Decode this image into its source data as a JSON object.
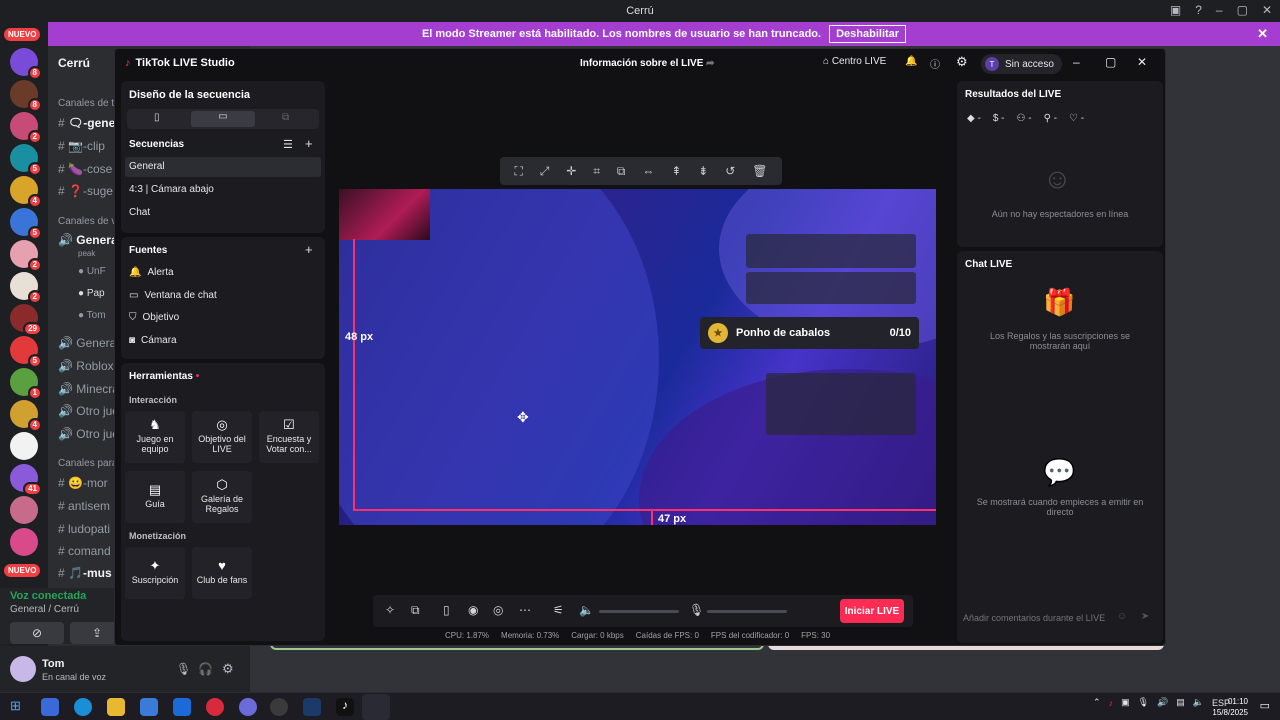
{
  "window_title": "Cerrú",
  "banner": {
    "text": "El modo Streamer está habilitado. Los nombres de usuario se han truncado.",
    "button": "Deshabilitar"
  },
  "rail": {
    "nuevo_top": "NUEVO",
    "nuevo_bottom": "NUEVO",
    "badges": [
      "8",
      "8",
      "2",
      "5",
      "4",
      "5",
      "2",
      "2",
      "29",
      "5",
      "1",
      "4",
      "41"
    ]
  },
  "server": {
    "name": "Cerrú"
  },
  "channels": {
    "cat_text": "Canales de te",
    "text": [
      "🗨-gene",
      "📷-clip",
      "🍆-cose",
      "❓-suge"
    ],
    "cat_voice": "Canales de vo",
    "general": "General",
    "general_sub": "peak",
    "members": [
      "UnF",
      "Pap",
      "Tom"
    ],
    "voice": [
      "General",
      "Roblox",
      "Minecra",
      "Otro jue",
      "Otro jue"
    ],
    "cat_para": "Canales para l",
    "para": [
      "😀-mor",
      "antisem",
      "ludopati",
      "comand",
      "🎵-mus"
    ]
  },
  "voice": {
    "status": "Voz conectada",
    "location": "General / Cerrú"
  },
  "user": {
    "name": "Tom",
    "status": "En canal de voz"
  },
  "studio": {
    "app_name": "TikTok LIVE Studio",
    "info": "Información sobre el LIVE",
    "centro": "Centro LIVE",
    "account": "Sin acceso",
    "account_initial": "T",
    "design_title": "Diseño de la secuencia",
    "secuencias": "Secuencias",
    "scenes": [
      "General",
      "4:3 | Cámara abajo",
      "Chat"
    ],
    "fuentes": "Fuentes",
    "sources": [
      {
        "icon": "bell-icon",
        "label": "Alerta"
      },
      {
        "icon": "chat-window-icon",
        "label": "Ventana de chat"
      },
      {
        "icon": "shield-icon",
        "label": "Objetivo"
      },
      {
        "icon": "camera-icon",
        "label": "Cámara"
      }
    ],
    "herramientas": "Herramientas",
    "interaccion": "Interacción",
    "tools": [
      {
        "label": "Juego en equipo",
        "icon": "joystick-icon"
      },
      {
        "label": "Objetivo del LIVE",
        "icon": "target-icon"
      },
      {
        "label": "Encuesta y Votar con...",
        "icon": "poll-icon"
      },
      {
        "label": "Guía",
        "icon": "gift-box-icon"
      },
      {
        "label": "Galería de Regalos",
        "icon": "gallery-icon"
      }
    ],
    "monetizacion": "Monetización",
    "money_tools": [
      {
        "label": "Suscripción",
        "icon": "star-icon"
      },
      {
        "label": "Club de fans",
        "icon": "heart-icon"
      }
    ],
    "goal": {
      "name": "Ponho de cabalos",
      "count": "0/10"
    },
    "measure_left": "48 px",
    "measure_bottom": "47 px",
    "go_live": "Iniciar LIVE",
    "stats": [
      "CPU: 1.87%",
      "Memoria: 0.73%",
      "Cargar: 0 kbps",
      "Caídas de FPS: 0",
      "FPS del codificador: 0",
      "FPS: 30"
    ],
    "results_title": "Resultados del LIVE",
    "results_metrics": [
      "-",
      "-",
      "-",
      "-",
      "-"
    ],
    "no_viewers": "Aún no hay espectadores en línea",
    "chat_title": "Chat LIVE",
    "chat_gifts": "Los Regalos y las suscripciones se mostrarán aquí",
    "chat_start": "Se mostrará cuando empieces a emitir en directo",
    "chat_placeholder": "Añadir comentarios durante el LIVE"
  },
  "taskbar": {
    "lang": "ESP",
    "time": "01:10",
    "date": "15/8/2025"
  },
  "colors": {
    "banner": "#a43ed1",
    "golive": "#fe2c55",
    "voice": "#23a55a"
  }
}
